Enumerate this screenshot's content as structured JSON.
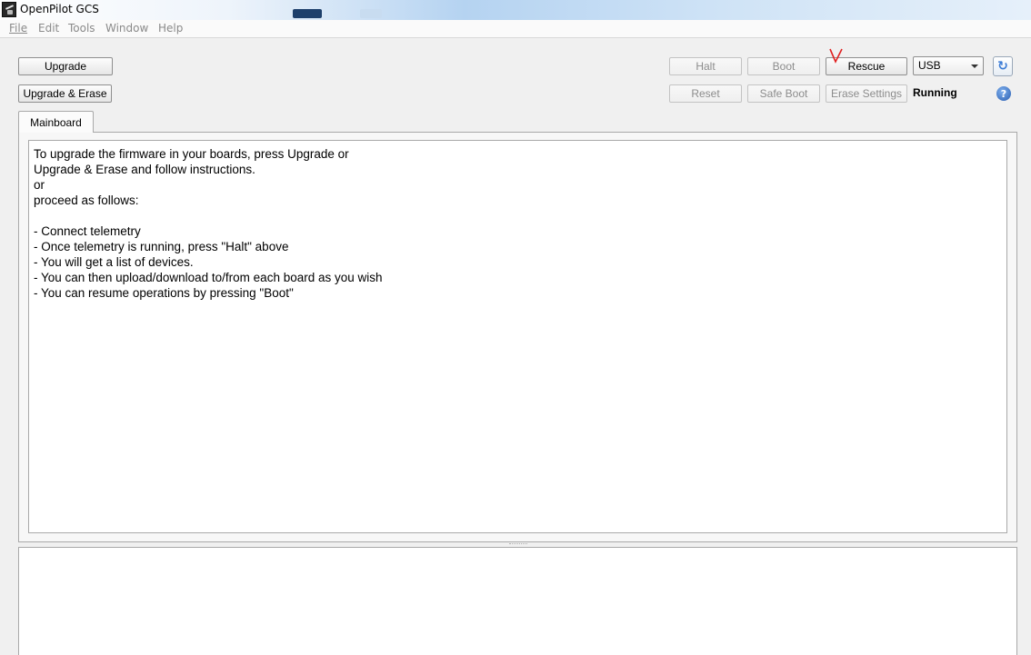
{
  "window": {
    "title": "OpenPilot GCS"
  },
  "menu": [
    "File",
    "Edit",
    "Tools",
    "Window",
    "Help"
  ],
  "toolbar": {
    "upgrade": "Upgrade",
    "upgrade_erase": "Upgrade & Erase",
    "halt": "Halt",
    "boot": "Boot",
    "rescue": "Rescue",
    "reset": "Reset",
    "safe_boot": "Safe Boot",
    "erase_settings": "Erase Settings",
    "connection": "USB",
    "status": "Running"
  },
  "tabs": [
    "Mainboard"
  ],
  "instructions": [
    "To upgrade the firmware in your boards, press Upgrade or",
    "Upgrade & Erase and follow instructions.",
    "or",
    "proceed as follows:",
    "",
    "- Connect telemetry",
    "- Once telemetry is running, press \"Halt\" above",
    "- You will get a list of devices.",
    "- You can then upload/download to/from each board as you wish",
    "- You can resume operations by pressing \"Boot\""
  ],
  "colors": {
    "annotation": "#e02020",
    "accent": "#3a7bd5"
  },
  "icons": {
    "app": "openpilot-app-icon",
    "refresh": "refresh-icon",
    "help": "help-icon"
  }
}
